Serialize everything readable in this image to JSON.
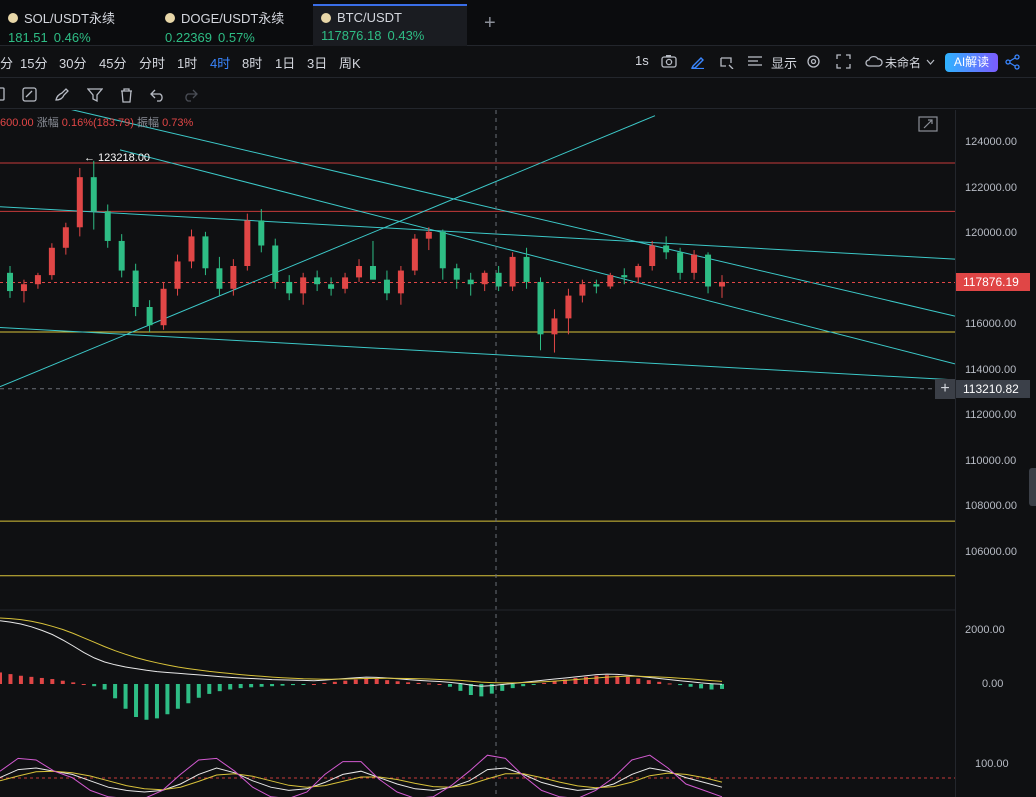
{
  "tabs": [
    {
      "name": "SOL/USDT永续",
      "price": "181.51",
      "change": "0.46%"
    },
    {
      "name": "DOGE/USDT永续",
      "price": "0.22369",
      "change": "0.57%"
    },
    {
      "name": "BTC/USDT",
      "price": "117876.18",
      "change": "0.43%"
    }
  ],
  "intervals": [
    "分",
    "15分",
    "30分",
    "45分",
    "分时",
    "1时",
    "4时",
    "8时",
    "1日",
    "3日",
    "周K"
  ],
  "active_interval": "4时",
  "toolbar": {
    "refresh_rate": "1s",
    "display_label": "显示",
    "layout_name": "未命名",
    "ai_label": "AI解读"
  },
  "header": {
    "prefix": "600.00",
    "change_label": "涨幅",
    "change_value": "0.16%(183.79)",
    "amp_label": "振幅",
    "amp_value": "0.73%"
  },
  "high_marker": "← 123218.00",
  "price_axis": [
    "124000.00",
    "122000.00",
    "120000.00",
    "116000.00",
    "114000.00",
    "112000.00",
    "110000.00",
    "108000.00",
    "106000.00"
  ],
  "current_price": "117876.19",
  "cursor_price": "113210.82",
  "macd_axis": [
    "2000.00",
    "0.00"
  ],
  "kdj_axis": [
    "100.00"
  ],
  "colors": {
    "up": "#e04646",
    "down": "#2ebd85",
    "trend": "#3cc8c8",
    "level": "#d8c23a",
    "resistance": "#c43a3a",
    "accent": "#3a86ff"
  },
  "chart_data": {
    "type": "candlestick",
    "interval": "4时",
    "ylim": [
      104000,
      125500
    ],
    "candles": [
      [
        118300,
        118600,
        117200,
        117500
      ],
      [
        117500,
        118000,
        117000,
        117800
      ],
      [
        117800,
        118300,
        117600,
        118200
      ],
      [
        118200,
        119600,
        118000,
        119400
      ],
      [
        119400,
        120500,
        119100,
        120300
      ],
      [
        120300,
        122900,
        119900,
        122500
      ],
      [
        122500,
        123218,
        120200,
        121000
      ],
      [
        121000,
        121300,
        119400,
        119700
      ],
      [
        119700,
        120000,
        118100,
        118400
      ],
      [
        118400,
        118700,
        116400,
        116800
      ],
      [
        116800,
        117100,
        115700,
        116000
      ],
      [
        116000,
        117900,
        115800,
        117600
      ],
      [
        117600,
        119100,
        117300,
        118800
      ],
      [
        118800,
        120200,
        118500,
        119900
      ],
      [
        119900,
        120100,
        118200,
        118500
      ],
      [
        118500,
        119000,
        117300,
        117600
      ],
      [
        117600,
        118900,
        117300,
        118600
      ],
      [
        118600,
        120900,
        118400,
        120600
      ],
      [
        120600,
        121100,
        119200,
        119500
      ],
      [
        119500,
        119800,
        117600,
        117900
      ],
      [
        117900,
        118200,
        117100,
        117400
      ],
      [
        117400,
        118300,
        116900,
        118100
      ],
      [
        118100,
        118400,
        117500,
        117800
      ],
      [
        117800,
        118100,
        117300,
        117600
      ],
      [
        117600,
        118300,
        117400,
        118100
      ],
      [
        118100,
        118900,
        117900,
        118600
      ],
      [
        118600,
        119700,
        118300,
        118000
      ],
      [
        118000,
        118400,
        117100,
        117400
      ],
      [
        117400,
        118600,
        116900,
        118400
      ],
      [
        118400,
        120000,
        118200,
        119800
      ],
      [
        119800,
        120300,
        119300,
        120100
      ],
      [
        120100,
        120200,
        118000,
        118500
      ],
      [
        118500,
        118700,
        117600,
        118000
      ],
      [
        118000,
        118300,
        117300,
        117800
      ],
      [
        117800,
        118400,
        117500,
        118300
      ],
      [
        118300,
        118600,
        117500,
        117700
      ],
      [
        117700,
        119200,
        117500,
        119000
      ],
      [
        119000,
        119400,
        117600,
        117900
      ],
      [
        117900,
        118100,
        114900,
        115600
      ],
      [
        115600,
        116700,
        114800,
        116300
      ],
      [
        116300,
        117600,
        115600,
        117300
      ],
      [
        117300,
        118000,
        117000,
        117800
      ],
      [
        117800,
        118000,
        117400,
        117700
      ],
      [
        117700,
        118300,
        117600,
        118200
      ],
      [
        118200,
        118500,
        117800,
        118100
      ],
      [
        118100,
        118700,
        117900,
        118600
      ],
      [
        118600,
        119700,
        118400,
        119500
      ],
      [
        119500,
        119900,
        118900,
        119200
      ],
      [
        119200,
        119400,
        118000,
        118300
      ],
      [
        118300,
        119300,
        118000,
        119100
      ],
      [
        119100,
        119200,
        117400,
        117700
      ],
      [
        117700,
        118200,
        117200,
        117900
      ]
    ],
    "horizontal_levels": [
      {
        "price": 123120,
        "color": "resistance"
      },
      {
        "price": 121000,
        "color": "resistance"
      },
      {
        "price": 115700,
        "color": "level"
      },
      {
        "price": 107400,
        "color": "level"
      },
      {
        "price": 105000,
        "color": "level"
      }
    ],
    "trendlines": [
      {
        "from": [
          0,
          121200
        ],
        "to": [
          955,
          118900
        ]
      },
      {
        "from": [
          0,
          126200
        ],
        "to": [
          955,
          116400
        ]
      },
      {
        "from": [
          120,
          123700
        ],
        "to": [
          955,
          114300
        ]
      },
      {
        "from": [
          0,
          115900
        ],
        "to": [
          955,
          113600
        ]
      },
      {
        "from": [
          0,
          113300
        ],
        "to": [
          655,
          125200
        ]
      }
    ],
    "macd_histogram": [
      420,
      360,
      300,
      260,
      220,
      180,
      120,
      60,
      0,
      -80,
      -200,
      -520,
      -900,
      -1200,
      -1300,
      -1250,
      -1100,
      -900,
      -700,
      -500,
      -360,
      -260,
      -200,
      -150,
      -120,
      -100,
      -80,
      -60,
      -40,
      -20,
      0,
      40,
      80,
      120,
      160,
      200,
      180,
      140,
      100,
      60,
      40,
      20,
      0,
      -100,
      -250,
      -400,
      -450,
      -350,
      -250,
      -150,
      -80,
      -20,
      40,
      100,
      160,
      220,
      260,
      300,
      320,
      300,
      260,
      200,
      140,
      80,
      20,
      -40,
      -100,
      -160,
      -200,
      -180
    ],
    "macd_dif": [
      2300,
      2250,
      2180,
      2080,
      1950,
      1800,
      1600,
      1380,
      1150,
      950,
      800,
      700,
      620,
      560,
      500,
      450,
      420,
      390,
      360,
      330,
      300,
      270,
      240,
      220,
      200,
      180,
      160,
      150,
      140,
      130,
      120,
      140,
      170,
      200,
      230,
      250,
      240,
      220,
      190,
      160,
      130,
      110,
      90,
      60,
      20,
      -40,
      -80,
      -60,
      -20,
      20,
      60,
      100,
      140,
      180,
      220,
      260,
      300,
      340,
      360,
      350,
      320,
      280,
      240,
      200,
      160,
      120,
      80,
      40,
      10,
      -10
    ],
    "macd_dea": [
      2400,
      2380,
      2340,
      2280,
      2200,
      2100,
      1980,
      1840,
      1680,
      1520,
      1360,
      1210,
      1080,
      960,
      860,
      770,
      690,
      620,
      560,
      510,
      460,
      420,
      380,
      340,
      310,
      280,
      250,
      230,
      210,
      190,
      180,
      175,
      175,
      180,
      190,
      200,
      205,
      208,
      205,
      200,
      190,
      180,
      165,
      150,
      130,
      100,
      70,
      50,
      40,
      40,
      50,
      65,
      85,
      105,
      130,
      160,
      190,
      220,
      250,
      270,
      280,
      280,
      270,
      255,
      235,
      210,
      185,
      155,
      125,
      95
    ],
    "kdj_k": [
      70,
      95,
      100,
      90,
      80,
      60,
      40,
      30,
      25,
      30,
      50,
      80,
      100,
      85,
      60,
      40,
      30,
      35,
      55,
      80,
      90,
      70,
      50,
      35,
      30,
      40,
      60,
      95,
      100,
      80,
      55,
      40,
      30,
      35,
      50,
      80,
      100,
      90,
      70,
      55,
      40
    ],
    "kdj_d": [
      60,
      75,
      88,
      90,
      85,
      75,
      60,
      45,
      35,
      32,
      40,
      58,
      78,
      82,
      74,
      60,
      46,
      40,
      45,
      58,
      72,
      72,
      64,
      52,
      42,
      40,
      48,
      66,
      82,
      82,
      70,
      56,
      44,
      38,
      42,
      56,
      76,
      84,
      80,
      70,
      56
    ],
    "kdj_j": [
      90,
      130,
      125,
      90,
      70,
      30,
      10,
      5,
      5,
      30,
      80,
      125,
      130,
      90,
      40,
      10,
      5,
      25,
      80,
      120,
      120,
      65,
      25,
      5,
      10,
      45,
      90,
      140,
      130,
      75,
      30,
      10,
      5,
      30,
      70,
      125,
      140,
      100,
      50,
      30,
      10
    ]
  }
}
